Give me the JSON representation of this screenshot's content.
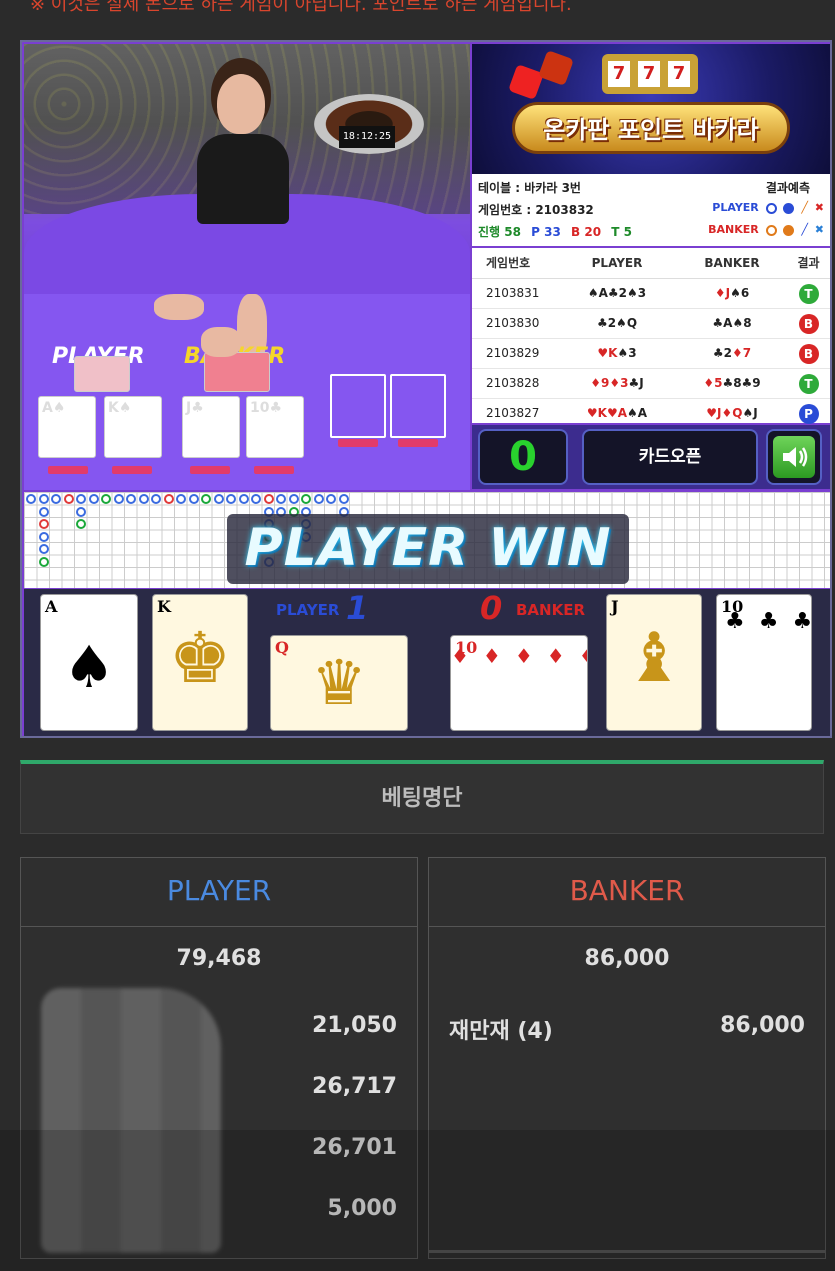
{
  "top_notice": "※ 이것은 실제 돈으로 하는 게임이 아닙니다. 포인트로 하는 게임입니다.",
  "video": {
    "clock": "18:12:25",
    "player_label": "PLAYER",
    "banker_label": "BANKER",
    "player_cards": [
      "A♠",
      "K♠"
    ],
    "banker_cards": [
      "J♣",
      "10♣"
    ]
  },
  "logo": {
    "title": "온카판 포인트 바카라",
    "slot": [
      "7",
      "7",
      "7"
    ]
  },
  "info": {
    "table": "테이블 : 바카라 3번",
    "game_no": "게임번호 : 2103832",
    "progress_label": "진행 58",
    "p_count": "P 33",
    "b_count": "B 20",
    "t_count": "T 5",
    "prediction_title": "결과예측",
    "pred_player": "PLAYER",
    "pred_banker": "BANKER"
  },
  "history": {
    "headers": [
      "게임번호",
      "PLAYER",
      "BANKER",
      "결과"
    ],
    "rows": [
      {
        "id": "2103831",
        "player": "♠A♣2♠3",
        "banker": "♦J♠6",
        "result": "T",
        "color": "#2eaa3a"
      },
      {
        "id": "2103830",
        "player": "♣2♠Q",
        "banker": "♣A♠8",
        "result": "B",
        "color": "#d82626"
      },
      {
        "id": "2103829",
        "player": "♥K♠3",
        "banker": "♣2♦7",
        "result": "B",
        "color": "#d82626"
      },
      {
        "id": "2103828",
        "player": "♦9♦3♣J",
        "banker": "♦5♣8♣9",
        "result": "T",
        "color": "#2eaa3a"
      },
      {
        "id": "2103827",
        "player": "♥K♥A♠A",
        "banker": "♥J♦Q♠J",
        "result": "P",
        "color": "#2a4cd6"
      }
    ]
  },
  "controls": {
    "counter": "0",
    "open_button": "카드오픈"
  },
  "win_banner": "PLAYER WIN",
  "result": {
    "player_label": "PLAYER",
    "player_score": "1",
    "banker_label": "BANKER",
    "banker_score": "0",
    "player_cards": [
      {
        "rank": "A",
        "suit": "♠",
        "color": "#000"
      },
      {
        "rank": "K",
        "suit": "♠",
        "color": "#000"
      },
      {
        "rank": "Q",
        "suit": "♦",
        "color": "#d82626"
      }
    ],
    "banker_cards": [
      {
        "rank": "10",
        "suit": "♦",
        "color": "#d82626"
      },
      {
        "rank": "J",
        "suit": "♣",
        "color": "#000"
      },
      {
        "rank": "10",
        "suit": "♣",
        "color": "#000"
      }
    ]
  },
  "betting": {
    "title": "베팅명단",
    "player": {
      "label": "PLAYER",
      "color": "#4a8ae0",
      "total": "79,468",
      "amounts": [
        "21,050",
        "26,717",
        "26,701",
        "5,000"
      ]
    },
    "banker": {
      "label": "BANKER",
      "color": "#e05a4a",
      "total": "86,000",
      "name": "재만재 (4)",
      "amount": "86,000"
    }
  },
  "colors": {
    "accent_green": "#2fa86a",
    "felt_purple": "#7b49e4"
  }
}
